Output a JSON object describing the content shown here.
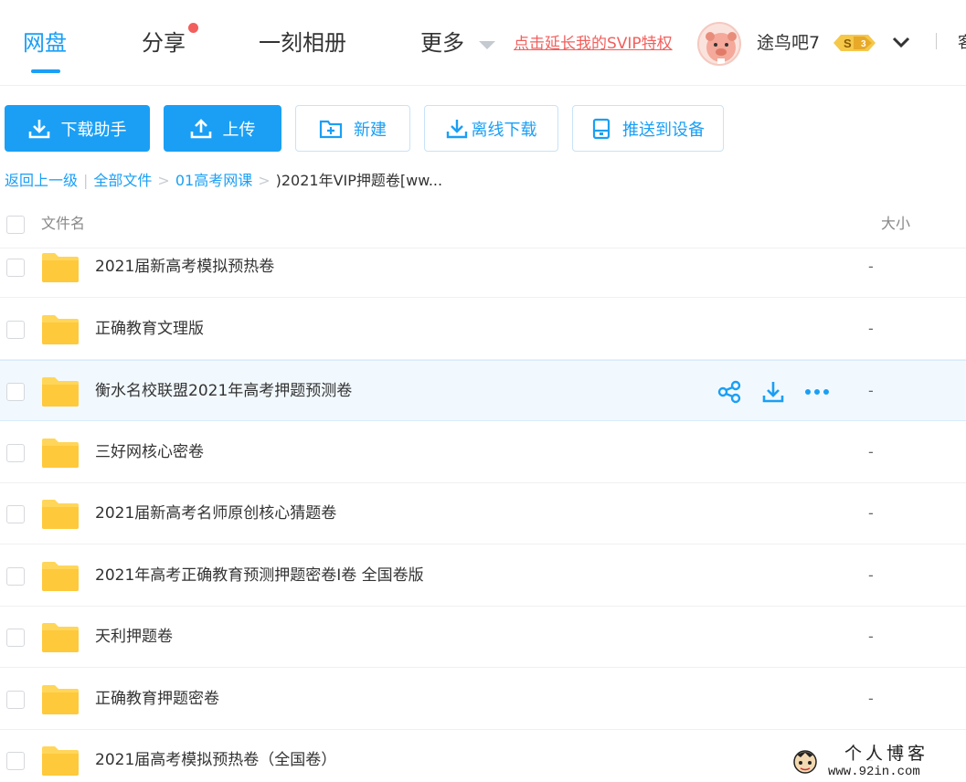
{
  "nav": {
    "tabs": [
      {
        "label": "网盘",
        "active": true
      },
      {
        "label": "分享",
        "has_badge": true
      },
      {
        "label": "一刻相册"
      },
      {
        "label": "更多"
      }
    ],
    "svip_link": "点击延长我的SVIP特权",
    "username": "途鸟吧7",
    "vip_level": "3",
    "vip_badge_letter": "S",
    "overflow_text": "客"
  },
  "toolbar": {
    "download_helper": "下载助手",
    "upload": "上传",
    "new": "新建",
    "offline_download": "离线下载",
    "push_to_device": "推送到设备"
  },
  "breadcrumb": {
    "back": "返回上一级",
    "all_files": "全部文件",
    "folder": "01高考网课",
    "current": ")2021年VIP押题卷[ww..."
  },
  "table": {
    "col_name": "文件名",
    "col_size": "大小",
    "rows": [
      {
        "name": "2021届新高考模拟预热卷",
        "size": "-"
      },
      {
        "name": "正确教育文理版",
        "size": "-"
      },
      {
        "name": "衡水名校联盟2021年高考押题预测卷",
        "size": "-",
        "hover": true
      },
      {
        "name": "三好网核心密卷",
        "size": "-"
      },
      {
        "name": "2021届新高考名师原创核心猜题卷",
        "size": "-"
      },
      {
        "name": "2021年高考正确教育预测押题密卷I卷 全国卷版",
        "size": "-"
      },
      {
        "name": "天利押题卷",
        "size": "-"
      },
      {
        "name": "正确教育押题密卷",
        "size": "-"
      },
      {
        "name": "2021届高考模拟预热卷（全国卷）",
        "size": "-"
      }
    ]
  },
  "watermark": {
    "title": "个人博客",
    "url": "www.92in.com"
  },
  "colors": {
    "accent": "#1a9ff5",
    "svip_red": "#f25f5c",
    "folder_yellow": "#ffd659"
  }
}
